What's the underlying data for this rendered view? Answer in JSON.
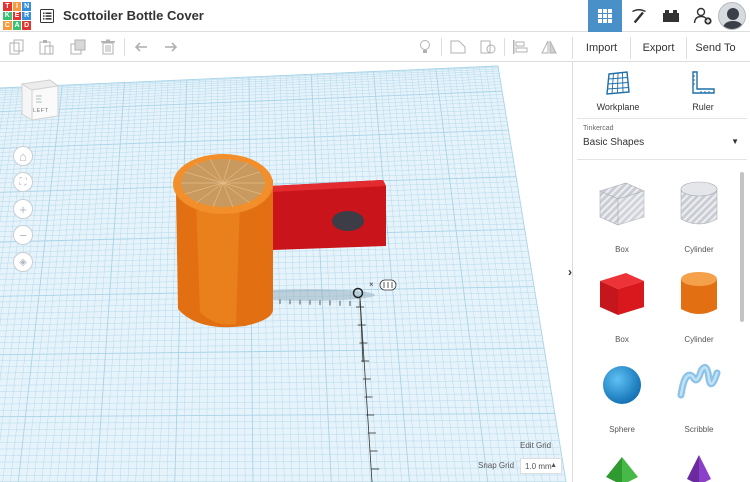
{
  "app": {
    "logo_letters": [
      "T",
      "I",
      "N",
      "K",
      "E",
      "R",
      "C",
      "A",
      "D"
    ],
    "logo_colors": [
      "#e3342f",
      "#f6993f",
      "#3490dc",
      "#38c172",
      "#e3342f",
      "#3490dc",
      "#f6993f",
      "#38c172",
      "#e3342f"
    ],
    "document_title": "Scottoiler Bottle Cover"
  },
  "header": {
    "views": [
      {
        "id": "3d-design",
        "icon": "grid-icon",
        "active": true
      },
      {
        "id": "blocks",
        "icon": "pickaxe-icon",
        "active": false
      },
      {
        "id": "bricks",
        "icon": "brick-icon",
        "active": false
      },
      {
        "id": "add-user",
        "icon": "add-user-icon",
        "active": false
      }
    ],
    "accent": "#4a90c8"
  },
  "toolbar": {
    "import_label": "Import",
    "export_label": "Export",
    "send_to_label": "Send To"
  },
  "viewport": {
    "viewcube_label": "LEFT",
    "edit_grid_label": "Edit Grid",
    "snap_grid_label": "Snap Grid",
    "snap_grid_value": "1.0 mm",
    "grid_color": "#a8d4e8",
    "grid_background": "#e6f3fa"
  },
  "panel": {
    "workplane_label": "Workplane",
    "ruler_label": "Ruler",
    "library_category": "Tinkercad",
    "library_name": "Basic Shapes",
    "shapes": [
      {
        "name": "Box",
        "style": "hole"
      },
      {
        "name": "Cylinder",
        "style": "hole"
      },
      {
        "name": "Box",
        "style": "solid",
        "color": "#d9181e"
      },
      {
        "name": "Cylinder",
        "style": "solid",
        "color": "#f07f13"
      },
      {
        "name": "Sphere",
        "style": "solid",
        "color": "#1a8cd4"
      },
      {
        "name": "Scribble",
        "style": "solid",
        "color": "#7fb8e0"
      }
    ]
  }
}
